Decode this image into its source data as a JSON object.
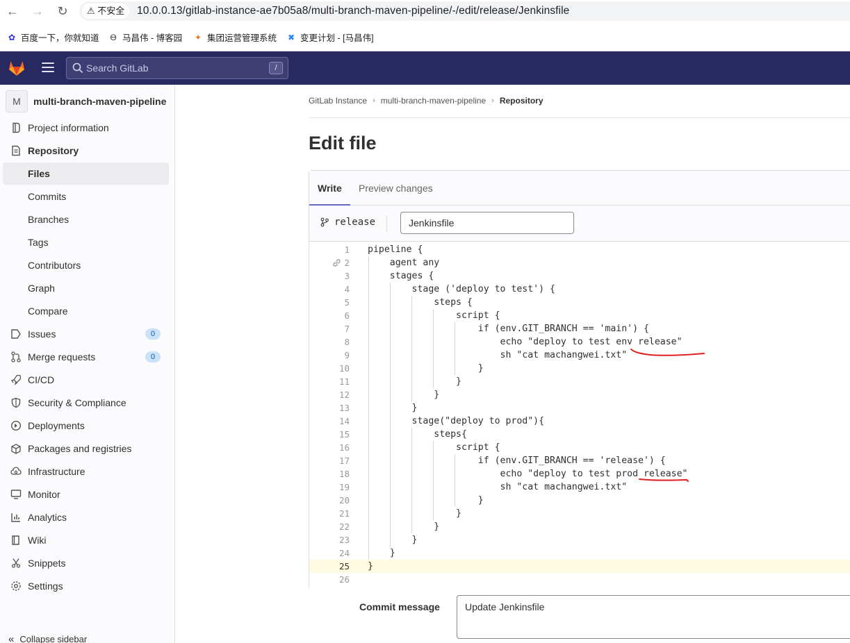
{
  "browser": {
    "security_label": "不安全",
    "url": "10.0.0.13/gitlab-instance-ae7b05a8/multi-branch-maven-pipeline/-/edit/release/Jenkinsfile",
    "bookmarks": [
      {
        "label": "百度一下，你就知道",
        "icon": "baidu-paw-icon"
      },
      {
        "label": "马昌伟 - 博客园",
        "icon": "cnblogs-icon"
      },
      {
        "label": "集团运营管理系统",
        "icon": "orange-spark-icon"
      },
      {
        "label": "变更计划 - [马昌伟]",
        "icon": "confluence-icon"
      }
    ]
  },
  "header": {
    "search_placeholder": "Search GitLab",
    "search_shortcut": "/"
  },
  "sidebar": {
    "project_avatar": "M",
    "project_name": "multi-branch-maven-pipeline",
    "items": [
      {
        "label": "Project information",
        "icon": "project-information-icon"
      },
      {
        "label": "Repository",
        "icon": "repository-icon"
      },
      {
        "label": "Files",
        "sub": true
      },
      {
        "label": "Commits",
        "sub": true
      },
      {
        "label": "Branches",
        "sub": true
      },
      {
        "label": "Tags",
        "sub": true
      },
      {
        "label": "Contributors",
        "sub": true
      },
      {
        "label": "Graph",
        "sub": true
      },
      {
        "label": "Compare",
        "sub": true
      },
      {
        "label": "Issues",
        "icon": "issues-icon",
        "count": "0"
      },
      {
        "label": "Merge requests",
        "icon": "merge-request-icon",
        "count": "0"
      },
      {
        "label": "CI/CD",
        "icon": "rocket-icon"
      },
      {
        "label": "Security & Compliance",
        "icon": "shield-icon"
      },
      {
        "label": "Deployments",
        "icon": "deployments-icon"
      },
      {
        "label": "Packages and registries",
        "icon": "package-icon"
      },
      {
        "label": "Infrastructure",
        "icon": "cloud-gear-icon"
      },
      {
        "label": "Monitor",
        "icon": "monitor-icon"
      },
      {
        "label": "Analytics",
        "icon": "chart-icon"
      },
      {
        "label": "Wiki",
        "icon": "book-icon"
      },
      {
        "label": "Snippets",
        "icon": "snippet-icon"
      },
      {
        "label": "Settings",
        "icon": "gear-icon"
      }
    ],
    "collapse_label": "Collapse sidebar"
  },
  "breadcrumb": [
    "GitLab Instance",
    "multi-branch-maven-pipeline",
    "Repository"
  ],
  "page_title": "Edit file",
  "editor": {
    "tabs": [
      "Write",
      "Preview changes"
    ],
    "branch": "release",
    "filename": "Jenkinsfile",
    "lines": [
      "pipeline {",
      "    agent any",
      "    stages {",
      "        stage ('deploy to test') {",
      "            steps {",
      "                script {",
      "                    if (env.GIT_BRANCH == 'main') {",
      "                        echo \"deploy to test env release\"",
      "                        sh \"cat machangwei.txt\"",
      "                    }",
      "                }",
      "            }",
      "        }",
      "        stage(\"deploy to prod\"){",
      "            steps{",
      "                script {",
      "                    if (env.GIT_BRANCH == 'release') {",
      "                        echo \"deploy to test prod release\"",
      "                        sh \"cat machangwei.txt\"",
      "                    }",
      "                }",
      "            }",
      "        }",
      "    }",
      "}",
      ""
    ],
    "current_line": 25
  },
  "commit": {
    "label": "Commit message",
    "message": "Update Jenkinsfile"
  },
  "colors": {
    "header_bg": "#292961",
    "annotation_red": "#e02020",
    "tab_active": "#6666c4"
  }
}
